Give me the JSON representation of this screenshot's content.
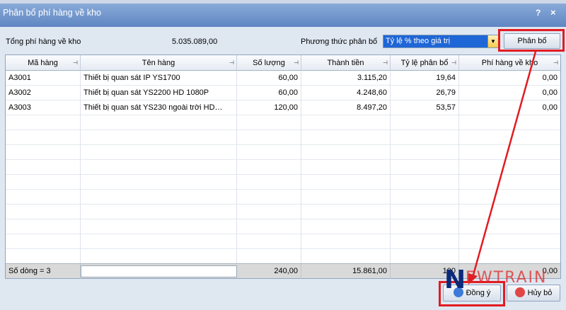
{
  "window": {
    "title": "Phân bổ phí hàng về kho",
    "help_label": "?",
    "close_label": "×"
  },
  "form": {
    "total_label": "Tổng phí hàng về kho",
    "total_value": "5.035.089,00",
    "method_label": "Phương thức phân bổ",
    "method_value": "Tỷ lệ % theo giá trị",
    "allocate_button": "Phân bổ"
  },
  "grid": {
    "columns": [
      "Mã hàng",
      "Tên hàng",
      "Số lượng",
      "Thành tiền",
      "Tỷ lệ phân bổ",
      "Phí hàng về kho"
    ],
    "rows": [
      {
        "code": "A3001",
        "name": "Thiết bị quan sát IP YS1700",
        "qty": "60,00",
        "amount": "3.115,20",
        "ratio": "19,64",
        "fee": "0,00"
      },
      {
        "code": "A3002",
        "name": "Thiết bị quan sát YS2200 HD 1080P",
        "qty": "60,00",
        "amount": "4.248,60",
        "ratio": "26,79",
        "fee": "0,00"
      },
      {
        "code": "A3003",
        "name": "Thiết bị quan sát YS230 ngoài trời HD…",
        "qty": "120,00",
        "amount": "8.497,20",
        "ratio": "53,57",
        "fee": "0,00"
      }
    ],
    "footer": {
      "row_count": "Số dòng = 3",
      "qty_total": "240,00",
      "amount_total": "15.861,00",
      "ratio_total": "100",
      "fee_total": "0,00"
    }
  },
  "buttons": {
    "ok": "Đồng ý",
    "cancel": "Hủy bỏ"
  },
  "watermark": {
    "letter": "N",
    "text": "EWTRAIN"
  },
  "colors": {
    "highlight": "#e11b22",
    "select_bg": "#1f66d6",
    "title_bar": "#6f93cc"
  }
}
